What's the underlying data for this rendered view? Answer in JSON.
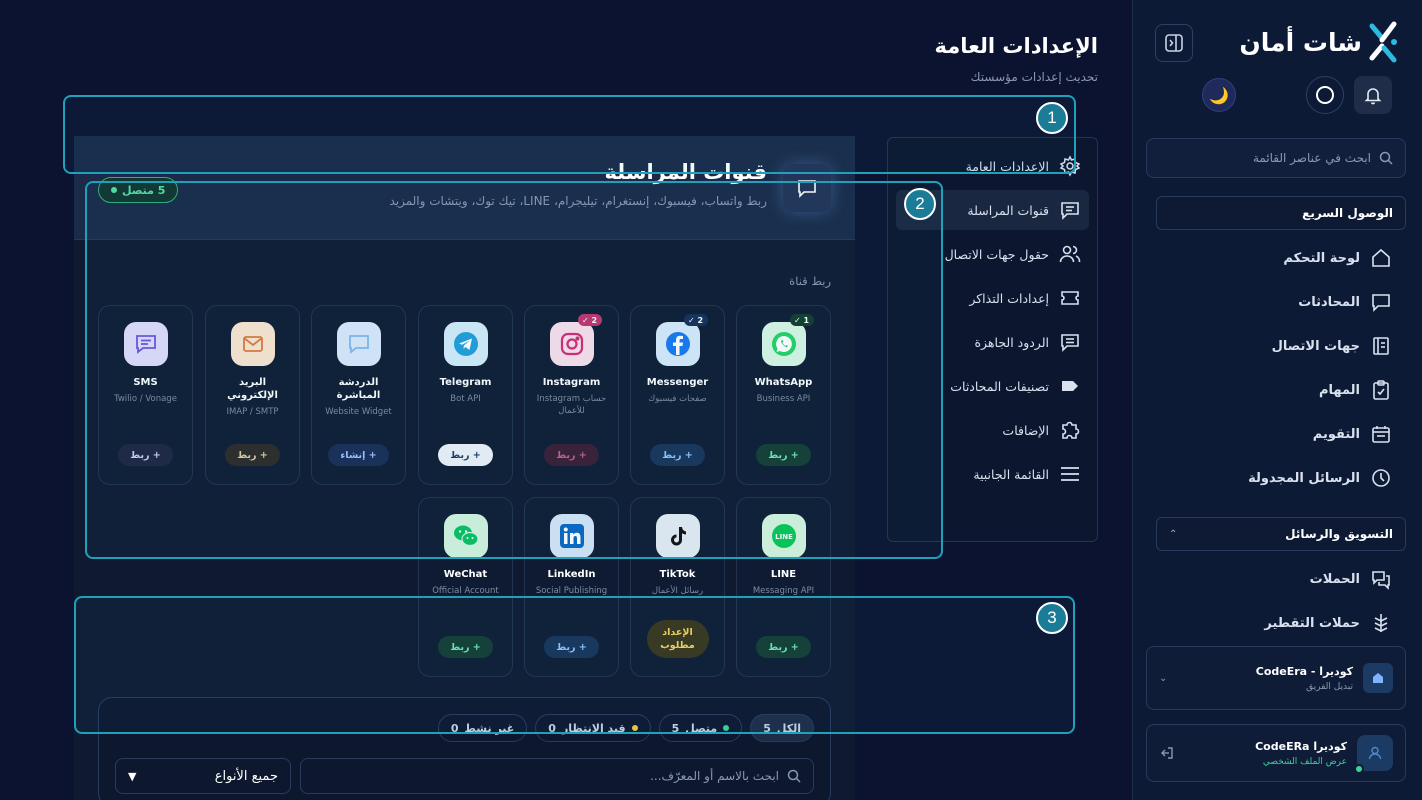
{
  "sidebar": {
    "brand": "شات أمان",
    "search_placeholder": "ابحث في عناصر القائمة",
    "quick_access": "الوصول السريع",
    "nav": [
      {
        "label": "لوحة التحكم",
        "icon": "home-icon"
      },
      {
        "label": "المحادثات",
        "icon": "chat-icon"
      },
      {
        "label": "جهات الاتصال",
        "icon": "contacts-book-icon"
      },
      {
        "label": "المهام",
        "icon": "clipboard-check-icon"
      },
      {
        "label": "التقويم",
        "icon": "calendar-icon"
      },
      {
        "label": "الرسائل المجدولة",
        "icon": "clock-icon"
      }
    ],
    "marketing": "التسويق والرسائل",
    "marketing_nav": [
      {
        "label": "الحملات",
        "icon": "campaigns-icon"
      },
      {
        "label": "حملات التقطير",
        "icon": "drip-icon"
      }
    ],
    "team": {
      "name": "كوديرا - CodeEra",
      "sub": "تبديل الفريق"
    },
    "profile": {
      "name": "كوديرا CodeERa",
      "sub": "عرض الملف الشخصي"
    }
  },
  "page": {
    "title": "الإعدادات العامة",
    "subtitle": "تحديث إعدادات مؤسستك"
  },
  "settings_menu": [
    {
      "label": "الإعدادات العامة",
      "icon": "gear-icon",
      "active": false
    },
    {
      "label": "قنوات المراسلة",
      "icon": "message-square-icon",
      "active": true
    },
    {
      "label": "حقول جهات الاتصال",
      "icon": "users-icon",
      "active": false
    },
    {
      "label": "إعدادات التذاكر",
      "icon": "ticket-icon",
      "active": false
    },
    {
      "label": "الردود الجاهزة",
      "icon": "canned-reply-icon",
      "active": false
    },
    {
      "label": "تصنيفات المحادثات",
      "icon": "tag-icon",
      "active": false
    },
    {
      "label": "الإضافات",
      "icon": "puzzle-icon",
      "active": false
    },
    {
      "label": "القائمة الجانبية",
      "icon": "menu-icon",
      "active": false
    }
  ],
  "channels": {
    "title": "قنوات المراسلة",
    "subtitle": "ربط واتساب، فيسبوك، إنستغرام، تيليجرام، LINE، تيك توك، ويتشات والمزيد",
    "connected_badge": "5 متصل",
    "connect_label": "ربط قناة",
    "cards": [
      {
        "name": "WhatsApp",
        "desc": "Business API",
        "badge": "1 ✓",
        "button": "+ ربط",
        "color": "#25D366"
      },
      {
        "name": "Messenger",
        "desc": "صفحات فيسبوك",
        "badge": "2 ✓",
        "button": "+ ربط",
        "color": "#1877F2"
      },
      {
        "name": "Instagram",
        "desc": "حساب Instagram للأعمال",
        "badge": "2 ✓",
        "button": "+ ربط",
        "color": "#E1306C"
      },
      {
        "name": "Telegram",
        "desc": "Bot API",
        "badge": "",
        "button": "+ ربط",
        "color": "#229ED9"
      },
      {
        "name": "الدردشة المباشرة",
        "desc": "Website Widget",
        "badge": "",
        "button": "+ إنشاء",
        "color": "#7FB8F0"
      },
      {
        "name": "البريد الإلكتروني",
        "desc": "IMAP / SMTP",
        "badge": "",
        "button": "+ ربط",
        "color": "#F0B070"
      },
      {
        "name": "SMS",
        "desc": "Twilio / Vonage",
        "badge": "",
        "button": "+ ربط",
        "color": "#8B7BF0"
      },
      {
        "name": "LINE",
        "desc": "Messaging API",
        "badge": "",
        "button": "+ ربط",
        "color": "#06C755"
      },
      {
        "name": "TikTok",
        "desc": "رسائل الأعمال",
        "badge": "",
        "button": "الإعداد مطلوب",
        "color": "#111111"
      },
      {
        "name": "LinkedIn",
        "desc": "Social Publishing",
        "badge": "",
        "button": "+ ربط",
        "color": "#0A66C2"
      },
      {
        "name": "WeChat",
        "desc": "Official Account",
        "badge": "",
        "button": "+ ربط",
        "color": "#07C160"
      }
    ]
  },
  "filters": {
    "tabs": [
      {
        "label": "الكل",
        "count": "5"
      },
      {
        "label": "متصل",
        "count": "5"
      },
      {
        "label": "قيد الانتظار",
        "count": "0"
      },
      {
        "label": "غير نشط",
        "count": "0"
      }
    ],
    "search_placeholder": "ابحث بالاسم أو المعرّف...",
    "type_select": "جميع الأنواع"
  },
  "callouts": [
    "1",
    "2",
    "3"
  ]
}
